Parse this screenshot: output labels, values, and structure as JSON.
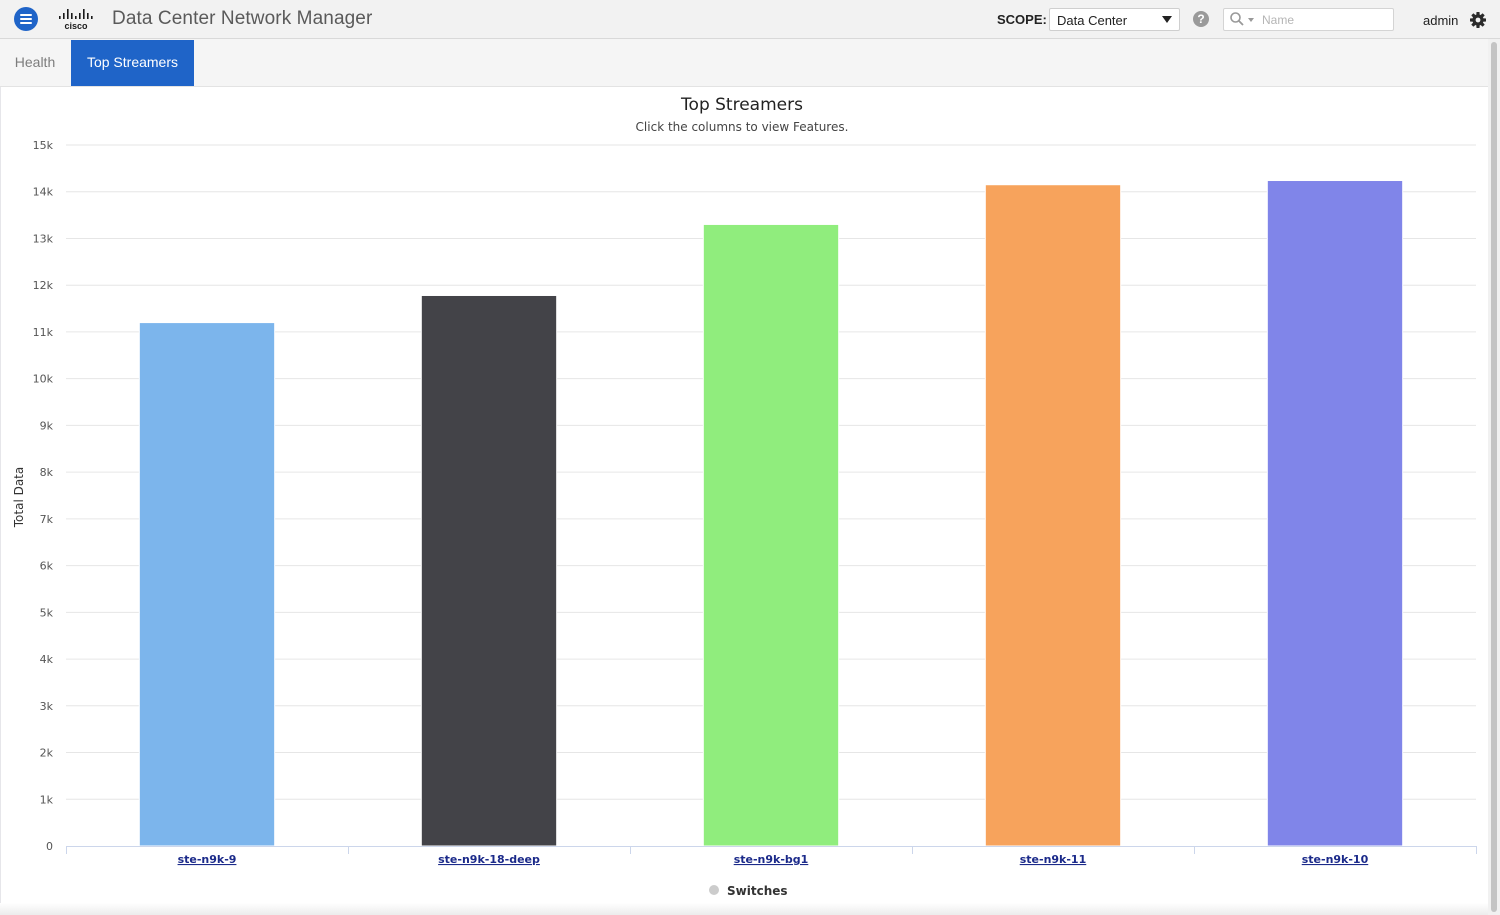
{
  "header": {
    "menu_icon": "hamburger-menu-icon",
    "logo_text": "cisco",
    "app_title": "Data Center Network Manager",
    "scope_label": "SCOPE:",
    "scope_value": "Data Center",
    "help_icon": "question-circle-icon",
    "help_glyph": "?",
    "search_placeholder": "Name",
    "search_icon": "magnifier-icon",
    "user": "admin",
    "settings_icon": "gear-icon",
    "colors": {
      "brand_blue": "#1f64c8",
      "topbar_bg": "#f2f2f2"
    }
  },
  "tabs": [
    {
      "label": "Health",
      "active": false
    },
    {
      "label": "Top Streamers",
      "active": true
    }
  ],
  "chart_data": {
    "type": "bar",
    "title": "Top Streamers",
    "subtitle": "Click the columns to view Features.",
    "ylabel": "Total Data",
    "xlabel": "",
    "categories": [
      "ste-n9k-9",
      "ste-n9k-18-deep",
      "ste-n9k-bg1",
      "ste-n9k-11",
      "ste-n9k-10"
    ],
    "values": [
      11200,
      11780,
      13300,
      14150,
      14240
    ],
    "colors": [
      "#7cb5ec",
      "#434348",
      "#90ed7d",
      "#f7a35c",
      "#8085e9"
    ],
    "ylim": [
      0,
      15000
    ],
    "yticks": [
      0,
      1000,
      2000,
      3000,
      4000,
      5000,
      6000,
      7000,
      8000,
      9000,
      10000,
      11000,
      12000,
      13000,
      14000,
      15000
    ],
    "ytick_labels": [
      "0",
      "1k",
      "2k",
      "3k",
      "4k",
      "5k",
      "6k",
      "7k",
      "8k",
      "9k",
      "10k",
      "11k",
      "12k",
      "13k",
      "14k",
      "15k"
    ],
    "grid": true,
    "legend": {
      "position": "bottom-center",
      "entries": [
        {
          "name": "Switches",
          "color": "#cccccc"
        }
      ]
    }
  }
}
